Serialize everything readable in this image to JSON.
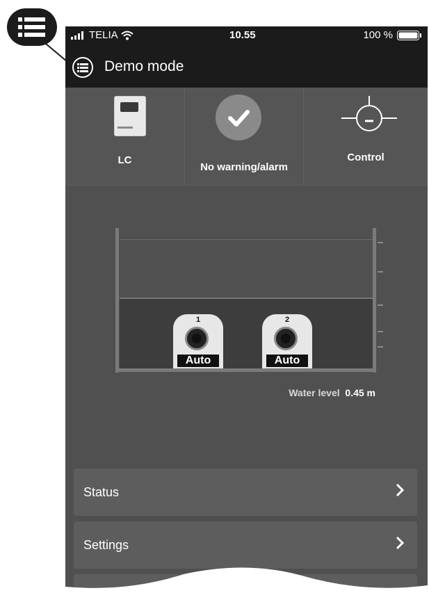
{
  "statusbar": {
    "carrier": "TELIA",
    "time": "10.55",
    "battery": "100 %"
  },
  "header": {
    "title": "Demo mode"
  },
  "tiles": [
    {
      "label": "LC",
      "icon": "controller-device-icon"
    },
    {
      "label": "No warning/alarm",
      "icon": "checkmark-icon"
    },
    {
      "label": "Control",
      "icon": "control-sensor-icon"
    }
  ],
  "pumps": [
    {
      "number": "1",
      "mode": "Auto"
    },
    {
      "number": "2",
      "mode": "Auto"
    }
  ],
  "water_level": {
    "label": "Water level",
    "value": "0.45 m"
  },
  "menu": [
    {
      "label": "Status"
    },
    {
      "label": "Settings"
    }
  ],
  "colors": {
    "background": "#505050",
    "bar": "#1b1b1b",
    "text": "#ffffff"
  }
}
